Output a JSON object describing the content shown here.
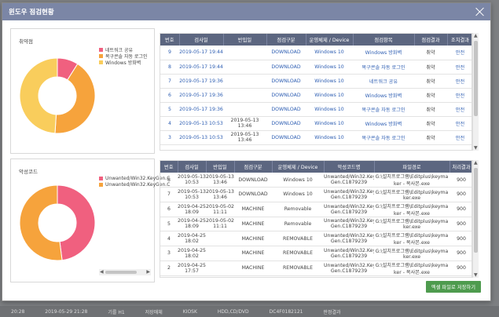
{
  "modal": {
    "title": "윈도우 점검현황",
    "save_button": "엑셀 파일로 저장하기"
  },
  "vuln_panel": {
    "title": "취약점",
    "legend": [
      {
        "label": "네트워크 공유",
        "color": "#f0607f"
      },
      {
        "label": "복구콘솔 자동 로그인",
        "color": "#f6a33c"
      },
      {
        "label": "Windows 방화벽",
        "color": "#f9cd5c"
      }
    ],
    "values": [
      9,
      42,
      49
    ]
  },
  "malware_panel": {
    "title": "악성코드",
    "legend": [
      {
        "label": "Unwanted/Win32.KeyGen.C",
        "color": "#f0607f"
      },
      {
        "label": "Unwanted/Win32.KeyGen.C",
        "color": "#f6a33c"
      }
    ],
    "values": [
      48,
      52
    ]
  },
  "vuln_table": {
    "headers": [
      "번호",
      "검사일",
      "반입일",
      "점검구분",
      "운영체제 / Device",
      "점검항목",
      "점검결과",
      "조치결과"
    ],
    "rows": [
      [
        "9",
        "2019-05-17 19:44",
        "",
        "DOWNLOAD",
        "Windows 10",
        "Windows 방화벽",
        "취약",
        "안전"
      ],
      [
        "8",
        "2019-05-17 19:44",
        "",
        "DOWNLOAD",
        "Windows 10",
        "복구콘솔 자동 로그인",
        "취약",
        "안전"
      ],
      [
        "7",
        "2019-05-17 19:36",
        "",
        "DOWNLOAD",
        "Windows 10",
        "네트워크 공유",
        "취약",
        "안전"
      ],
      [
        "6",
        "2019-05-17 19:36",
        "",
        "DOWNLOAD",
        "Windows 10",
        "Windows 방화벽",
        "취약",
        "안전"
      ],
      [
        "5",
        "2019-05-17 19:36",
        "",
        "DOWNLOAD",
        "Windows 10",
        "복구콘솔 자동 로그인",
        "취약",
        "안전"
      ],
      [
        "4",
        "2019-05-13 10:53",
        "2019-05-13 13:46",
        "DOWNLOAD",
        "Windows 10",
        "Windows 방화벽",
        "취약",
        "안전"
      ],
      [
        "3",
        "2019-05-13 10:53",
        "2019-05-13 13:46",
        "DOWNLOAD",
        "Windows 10",
        "복구콘솔 자동 로그인",
        "취약",
        "안전"
      ]
    ]
  },
  "malware_table": {
    "headers": [
      "번호",
      "검사일",
      "반입일",
      "점검구분",
      "운영체제 / Device",
      "악성코드명",
      "파일경로",
      "처리결과"
    ],
    "rows": [
      [
        "8",
        "2019-05-13 10:53",
        "2019-05-13 13:46",
        "DOWNLOAD",
        "Windows 10",
        "Unwanted/Win32.Key Gen.C1879239",
        "G:\\설치프로그램\\Editplus\\keyma ker - 복사본.exe",
        "900"
      ],
      [
        "7",
        "2019-05-13 10:53",
        "2019-05-13 13:46",
        "DOWNLOAD",
        "Windows 10",
        "Unwanted/Win32.Key Gen.C1879239",
        "G:\\설치프로그램\\Editplus\\keyma ker.exe",
        "900"
      ],
      [
        "6",
        "2019-04-25 18:09",
        "2019-05-02 11:11",
        "MACHINE",
        "Removable",
        "Unwanted/Win32.Key Gen.C1879239",
        "G:\\설치프로그램\\Editplus\\keyma ker - 복사본.exe",
        "900"
      ],
      [
        "5",
        "2019-04-25 18:09",
        "2019-05-02 11:11",
        "MACHINE",
        "Removable",
        "Unwanted/Win32.Key Gen.C1879239",
        "G:\\설치프로그램\\Editplus\\keyma ker.exe",
        "900"
      ],
      [
        "4",
        "2019-04-25 18:02",
        "",
        "MACHINE",
        "REMOVABLE",
        "Unwanted/Win32.Key Gen.C1879239",
        "G:\\설치프로그램\\Editplus\\keyma ker - 복사본.exe",
        "900"
      ],
      [
        "3",
        "2019-04-25 18:02",
        "",
        "MACHINE",
        "REMOVABLE",
        "Unwanted/Win32.Key Gen.C1879239",
        "G:\\설치프로그램\\Editplus\\keyma ker.exe",
        "900"
      ],
      [
        "2",
        "2019-04-25 17:57",
        "",
        "MACHINE",
        "REMOVABLE",
        "Unwanted/Win32.Key Gen.C1879239",
        "G:\\설치프로그램\\Editplus\\keyma ker - 복사본.exe",
        "900"
      ],
      [
        "1",
        "2019-04-25",
        "",
        "MACHINE",
        "REMOVABLE",
        "Unwanted/Win32.Key",
        "G:\\설치프로그램\\Editplus\\keyma",
        "900"
      ]
    ]
  },
  "background": {
    "strip": [
      "20:28",
      "2019-05-29 21:28",
      "기를 H1",
      "저장매체",
      "KIOSK",
      "HDD,CD/DVD",
      "DC4F0182121",
      "판정결과"
    ]
  }
}
